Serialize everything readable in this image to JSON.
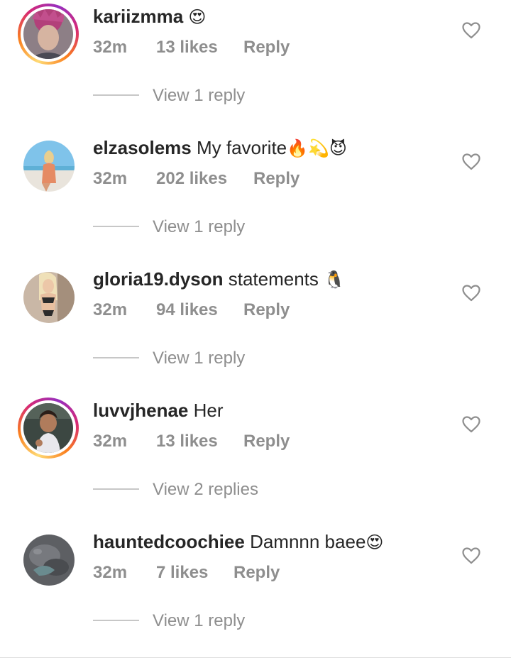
{
  "comments": [
    {
      "username": "kariizmma",
      "text": "",
      "emoji": "😍",
      "time": "32m",
      "likes": "13 likes",
      "reply_label": "Reply",
      "view_replies": "View 1 reply",
      "story_ring": true
    },
    {
      "username": "elzasolems",
      "text": "My favorite",
      "emoji": "🔥💫😈",
      "time": "32m",
      "likes": "202 likes",
      "reply_label": "Reply",
      "view_replies": "View 1 reply",
      "story_ring": false
    },
    {
      "username": "gloria19.dyson",
      "text": "statements",
      "emoji": "🐧",
      "time": "32m",
      "likes": "94 likes",
      "reply_label": "Reply",
      "view_replies": "View 1 reply",
      "story_ring": false
    },
    {
      "username": "luvvjhenae",
      "text": "Her",
      "emoji": "",
      "time": "32m",
      "likes": "13 likes",
      "reply_label": "Reply",
      "view_replies": "View 2 replies",
      "story_ring": true
    },
    {
      "username": "hauntedcoochiee",
      "text": "Damnnn baee",
      "emoji": "😍",
      "time": "32m",
      "likes": "7 likes",
      "reply_label": "Reply",
      "view_replies": "View 1 reply",
      "story_ring": false
    }
  ],
  "icons": {
    "like": "heart-outline-icon"
  },
  "colors": {
    "text_primary": "#262626",
    "text_secondary": "#8e8e8e",
    "divider": "#c7c7c7",
    "story_ring_start": "#feda75",
    "story_ring_end": "#962fbf"
  }
}
